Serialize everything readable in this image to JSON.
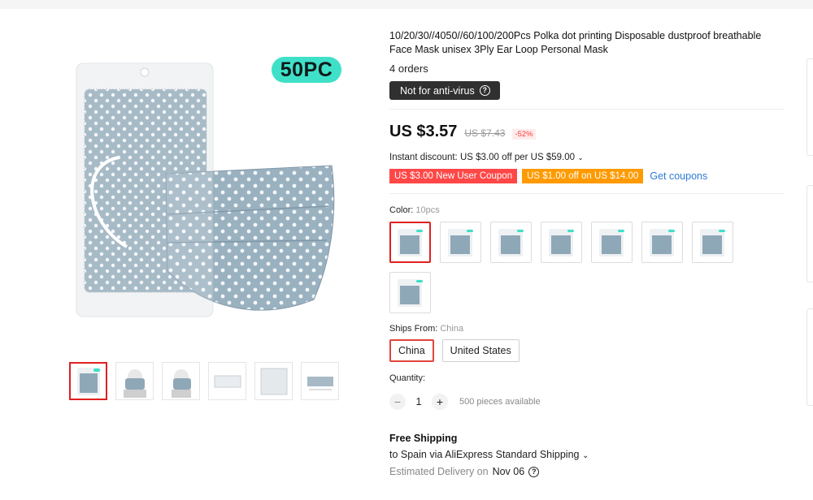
{
  "main_image": {
    "badge": "50PC"
  },
  "product": {
    "title": "10/20/30//4050//60/100/200Pcs Polka dot printing Disposable dustproof breathable Face Mask unisex 3Ply Ear Loop Personal Mask",
    "orders": "4 orders",
    "notice": "Not for anti-virus",
    "price": "US $3.57",
    "old_price": "US $7.43",
    "discount": "-52%",
    "instant_discount": "Instant discount: US $3.00 off per US $59.00",
    "coupons": [
      "US $3.00 New User Coupon",
      "US $1.00 off on US $14.00"
    ],
    "get_coupons": "Get coupons"
  },
  "color": {
    "label": "Color:",
    "value": "10pcs",
    "option_count": 8,
    "selected_index": 0
  },
  "ships_from": {
    "label": "Ships From:",
    "value": "China",
    "options": [
      "China",
      "United States"
    ]
  },
  "quantity": {
    "label": "Quantity:",
    "minus": "−",
    "plus": "+",
    "value": "1",
    "available": "500 pieces available"
  },
  "shipping": {
    "free": "Free Shipping",
    "to": "to Spain via AliExpress Standard Shipping",
    "est_label": "Estimated Delivery on",
    "est_date": "Nov 06"
  },
  "colors": {
    "accent_red": "#e02020",
    "coupon_red": "#ff4747",
    "coupon_orange": "#ff9a00",
    "link_blue": "#2e7bd6",
    "badge_teal": "#3fe0c8",
    "mask_blue": "#8fa8b8"
  },
  "icons": [
    "question-icon",
    "chevron-down-icon"
  ]
}
